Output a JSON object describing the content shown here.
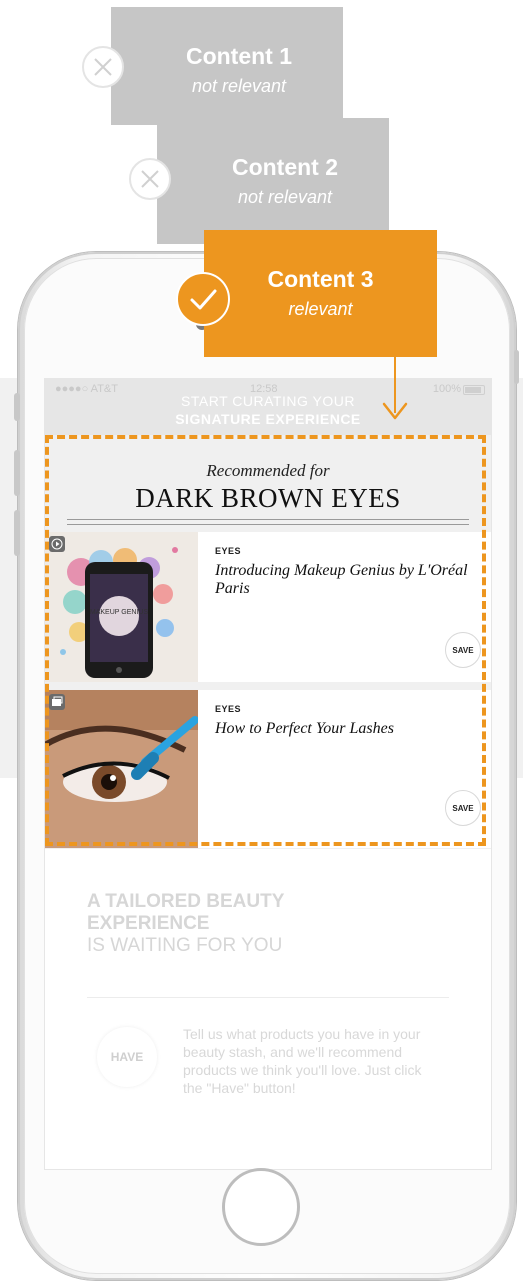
{
  "cards": [
    {
      "title": "Content 1",
      "subtitle": "not relevant",
      "status": "x-icon"
    },
    {
      "title": "Content 2",
      "subtitle": "not relevant",
      "status": "x-icon"
    },
    {
      "title": "Content 3",
      "subtitle": "relevant",
      "status": "check-icon"
    }
  ],
  "status_bar": {
    "carrier": "●●●●○ AT&T",
    "time": "12:58",
    "battery": "100%"
  },
  "banner": {
    "line1": "START CURATING YOUR",
    "line2": "SIGNATURE EXPERIENCE"
  },
  "recommendation": {
    "lead": "Recommended for",
    "headline": "DARK BROWN EYES",
    "items": [
      {
        "category": "EYES",
        "title": "Introducing Makeup Genius by L'Oréal Paris",
        "save_label": "SAVE",
        "media": "video",
        "image_text": "MAKEUP GENIUS"
      },
      {
        "category": "EYES",
        "title": "How to Perfect Your Lashes",
        "save_label": "SAVE",
        "media": "gallery"
      }
    ]
  },
  "tailored": {
    "line1": "A TAILORED BEAUTY",
    "line2": "EXPERIENCE",
    "line3": "IS WAITING FOR YOU"
  },
  "have": {
    "button_label": "HAVE",
    "text": "Tell us what products you have in your beauty stash, and we'll recommend products we think you'll love. Just click the \"Have\" button!"
  },
  "colors": {
    "accent": "#ed961f",
    "muted_card": "#c6c6c6"
  }
}
